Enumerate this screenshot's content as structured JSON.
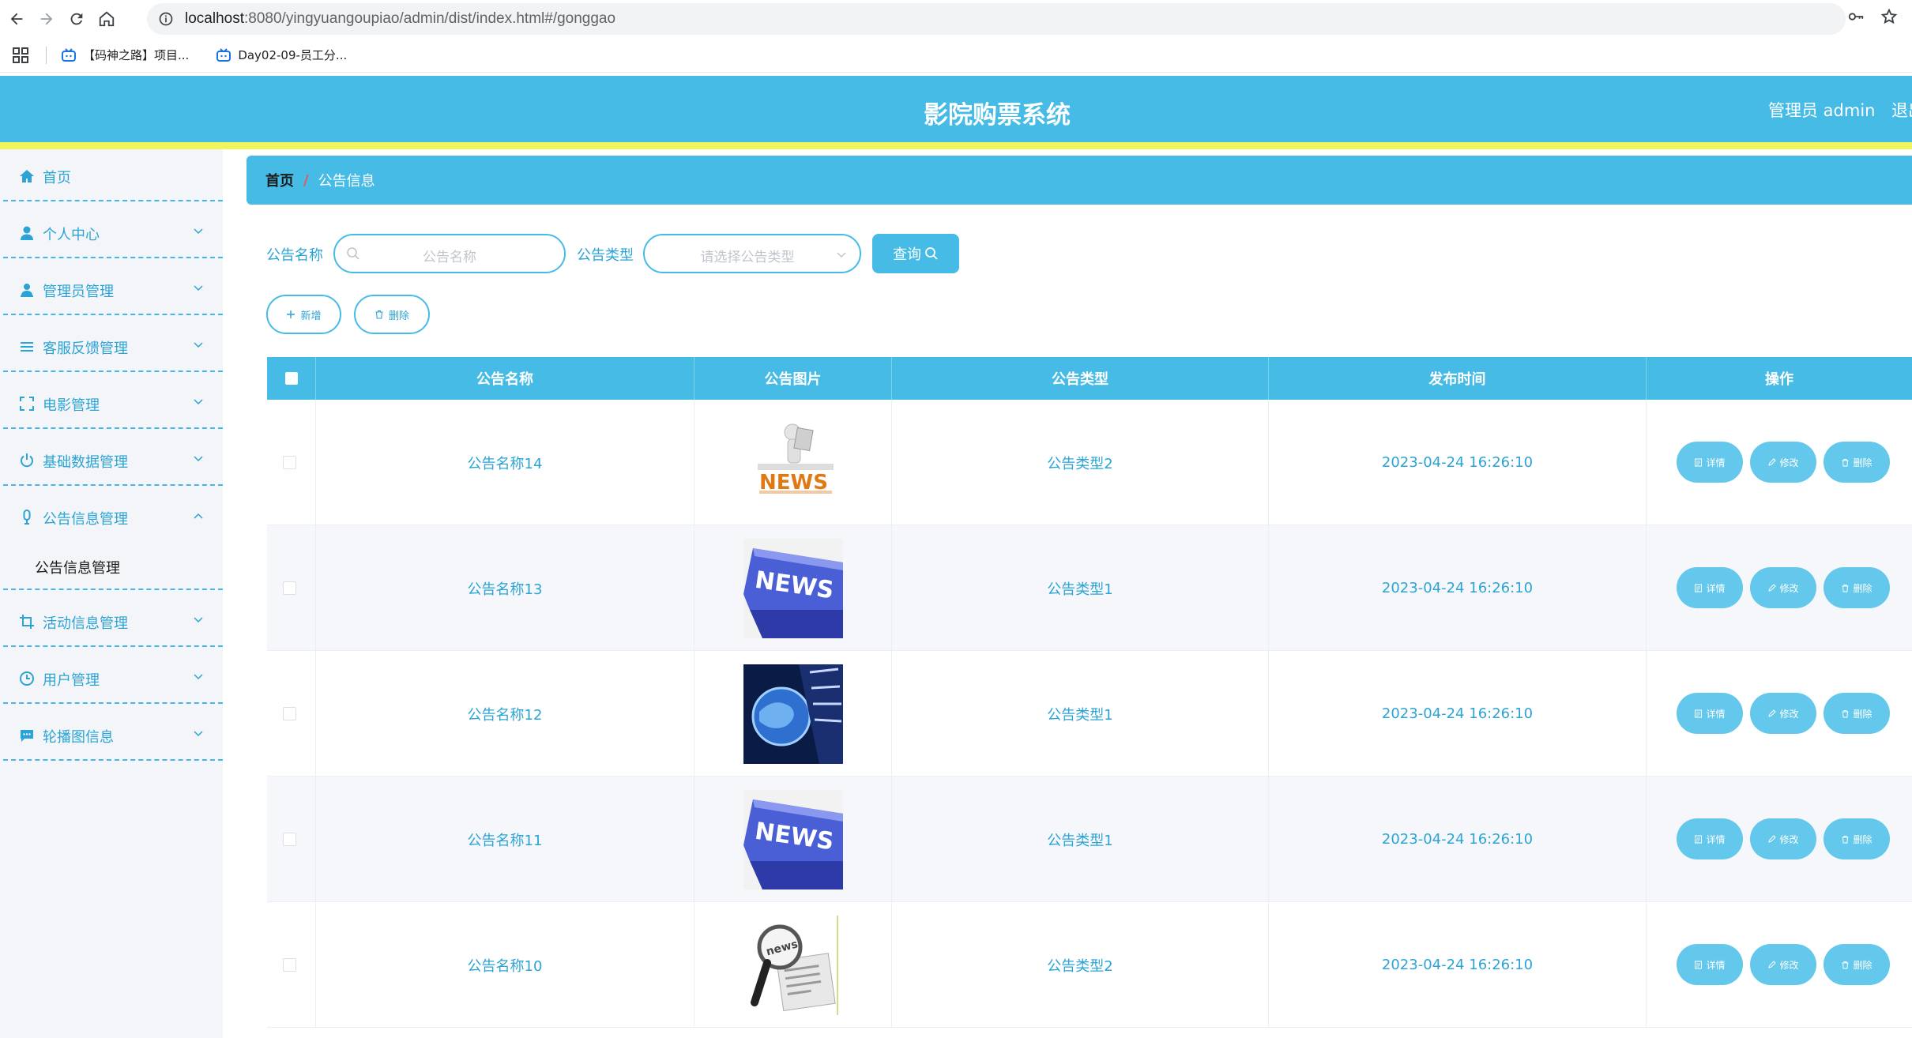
{
  "browser": {
    "url_host": "localhost",
    "url_rest": ":8080/yingyuangoupiao/admin/dist/index.html#/gonggao",
    "bookmarks": [
      {
        "label": "【码神之路】项目..."
      },
      {
        "label": "Day02-09-员工分..."
      }
    ]
  },
  "header": {
    "title": "影院购票系统",
    "user": "管理员 admin",
    "logout": "退出"
  },
  "sidebar": {
    "items": [
      {
        "label": "首页",
        "icon": "home-icon"
      },
      {
        "label": "个人中心",
        "icon": "user-icon"
      },
      {
        "label": "管理员管理",
        "icon": "admin-icon"
      },
      {
        "label": "客服反馈管理",
        "icon": "list-icon"
      },
      {
        "label": "电影管理",
        "icon": "fullscreen-icon"
      },
      {
        "label": "基础数据管理",
        "icon": "power-icon"
      },
      {
        "label": "公告信息管理",
        "icon": "microphone-icon"
      },
      {
        "label": "活动信息管理",
        "icon": "crop-icon"
      },
      {
        "label": "用户管理",
        "icon": "clock-icon"
      },
      {
        "label": "轮播图信息",
        "icon": "chat-icon"
      }
    ],
    "sub_item": "公告信息管理"
  },
  "breadcrumb": {
    "home": "首页",
    "separator": "/",
    "current": "公告信息"
  },
  "search": {
    "name_label": "公告名称",
    "name_placeholder": "公告名称",
    "type_label": "公告类型",
    "type_placeholder": "请选择公告类型",
    "query_button": "查询"
  },
  "actions": {
    "add": "新增",
    "delete": "删除"
  },
  "table": {
    "columns": [
      "公告名称",
      "公告图片",
      "公告类型",
      "发布时间",
      "操作"
    ],
    "row_buttons": {
      "detail": "详情",
      "edit": "修改",
      "delete": "删除"
    },
    "rows": [
      {
        "name": "公告名称14",
        "image": "news-3d-figure",
        "type": "公告类型2",
        "time": "2023-04-24 16:26:10"
      },
      {
        "name": "公告名称13",
        "image": "news-blue-key",
        "type": "公告类型1",
        "time": "2023-04-24 16:26:10"
      },
      {
        "name": "公告名称12",
        "image": "globe-news",
        "type": "公告类型1",
        "time": "2023-04-24 16:26:10"
      },
      {
        "name": "公告名称11",
        "image": "news-blue-key",
        "type": "公告类型1",
        "time": "2023-04-24 16:26:10"
      },
      {
        "name": "公告名称10",
        "image": "news-magnifier",
        "type": "公告类型2",
        "time": "2023-04-24 16:26:10"
      }
    ]
  },
  "colors": {
    "primary": "#46bbe6",
    "accent_strip": "#f0f55a",
    "link_text": "#2ba4d5",
    "sidebar_bg": "#f4f5f8"
  }
}
